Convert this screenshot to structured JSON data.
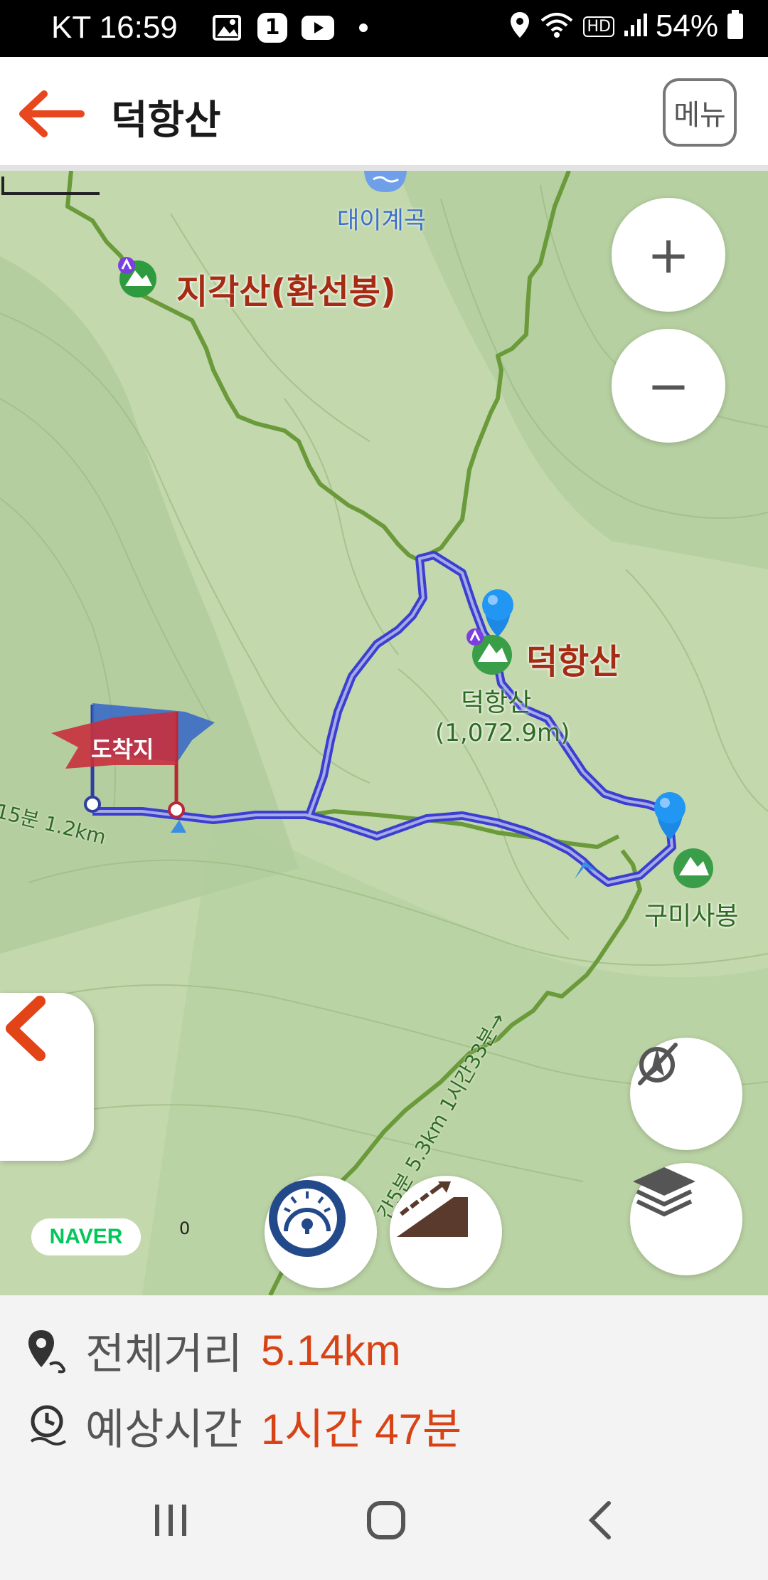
{
  "status_bar": {
    "carrier_time": "KT 16:59",
    "notification_badge": "1",
    "hd_label": "HD",
    "battery": "54%",
    "icons": [
      "gallery-icon",
      "youtube-icon",
      "location-icon",
      "wifi-icon",
      "signal-icon",
      "battery-icon"
    ]
  },
  "header": {
    "title": "덕항산",
    "menu_label": "메뉴",
    "accent_color": "#e8461e"
  },
  "map": {
    "labels": {
      "valley": "대이계곡",
      "peak1": "지각산(환선봉)",
      "peak2": "덕항산",
      "peak2_sub_name": "덕항산",
      "peak2_elevation": "(1,072.9m)",
      "peak3": "구미사봉",
      "destination_flag": "도착지",
      "trail_note_left": "15분 1.2km",
      "trail_note_bottom": "간5분 5.3km 1시간33분→"
    },
    "controls": {
      "zoom_in": "+",
      "zoom_out": "−"
    },
    "brand": "NAVER",
    "scale_zero": "0",
    "route_color": "#3a3fd0",
    "trail_color": "#6a9a3a"
  },
  "summary": {
    "distance_label": "전체거리",
    "distance_value": "5.14km",
    "time_label": "예상시간",
    "time_value": "1시간 47분",
    "value_color": "#d84315"
  },
  "nav": {
    "buttons": [
      "recents",
      "home",
      "back"
    ]
  }
}
